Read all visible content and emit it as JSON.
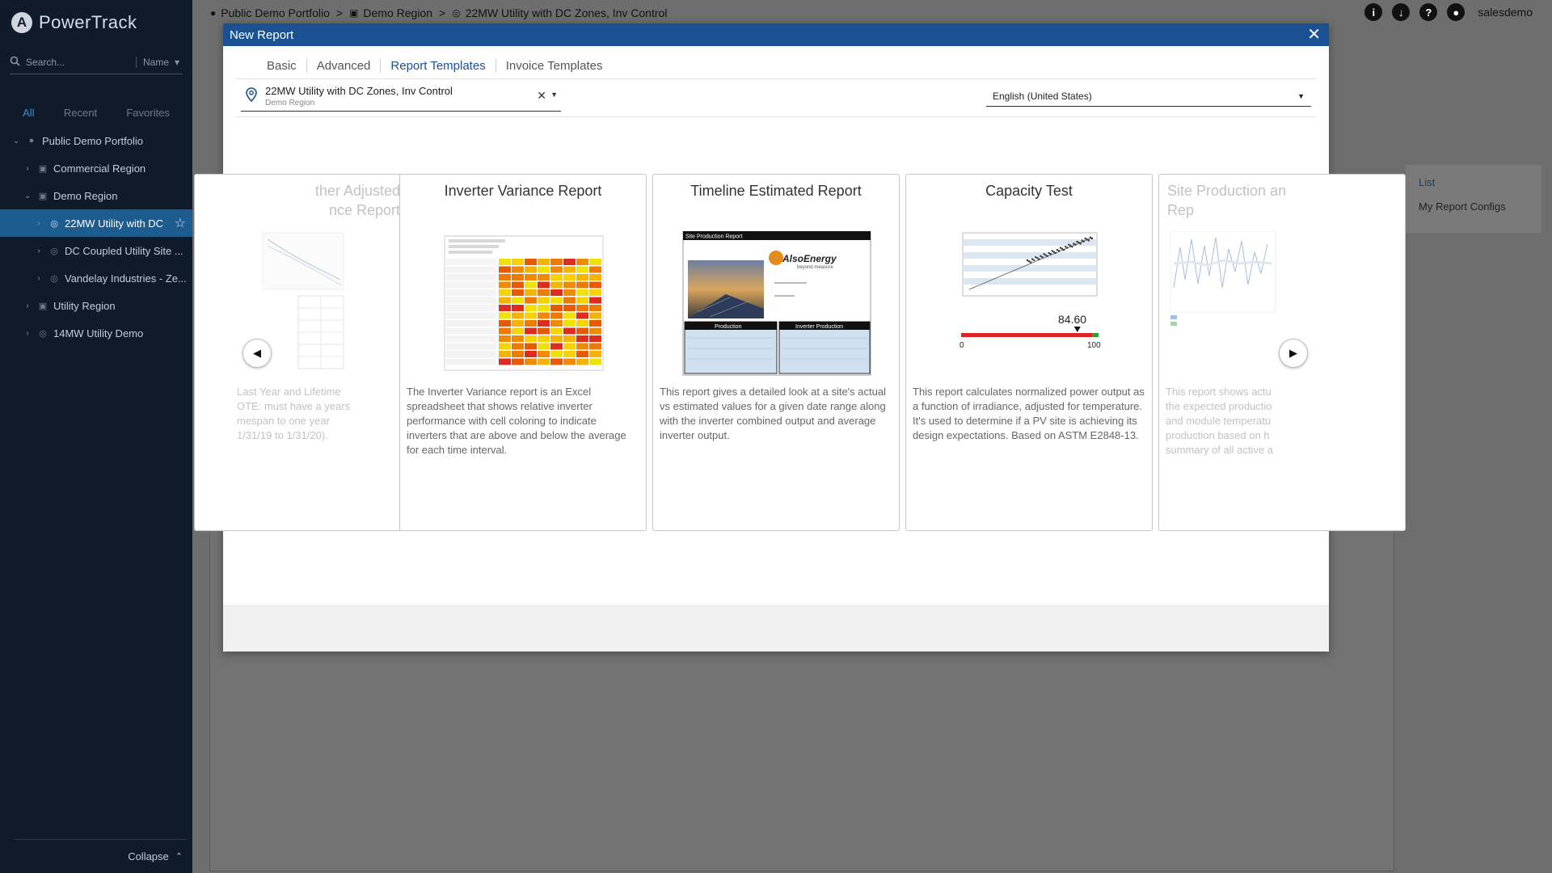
{
  "app": {
    "brand": "PowerTrack",
    "brand_initial": "A"
  },
  "sidebar": {
    "search_placeholder": "Search...",
    "sort_label": "Name",
    "tabs": [
      {
        "label": "All",
        "active": true
      },
      {
        "label": "Recent"
      },
      {
        "label": "Favorites"
      }
    ],
    "tree": [
      {
        "label": "Public Demo Portfolio",
        "level": 0,
        "chev": "⌄",
        "icon": "globe-icon"
      },
      {
        "label": "Commercial Region",
        "level": 1,
        "chev": "›",
        "icon": "briefcase-icon"
      },
      {
        "label": "Demo Region",
        "level": 1,
        "chev": "⌄",
        "icon": "briefcase-icon"
      },
      {
        "label": "22MW Utility with DC",
        "level": 2,
        "chev": "›",
        "icon": "pin-icon",
        "selected": true
      },
      {
        "label": "DC Coupled Utility Site ...",
        "level": 2,
        "chev": "›",
        "icon": "pin-icon"
      },
      {
        "label": "Vandelay Industries - Ze...",
        "level": 2,
        "chev": "›",
        "icon": "pin-icon"
      },
      {
        "label": "Utility Region",
        "level": 1,
        "chev": "›",
        "icon": "briefcase-icon"
      },
      {
        "label": "14MW Utility Demo",
        "level": 1,
        "chev": "›",
        "icon": "pin-icon"
      }
    ],
    "collapse_label": "Collapse"
  },
  "topbar": {
    "breadcrumb": [
      "Public Demo Portfolio",
      "Demo Region",
      "22MW Utility with DC Zones, Inv Control"
    ],
    "separator": ">",
    "user": "salesdemo",
    "info_glyph": "i",
    "help_glyph": "?"
  },
  "background": {
    "right_panel": [
      "List",
      "My Report Configs"
    ]
  },
  "modal": {
    "title": "New Report",
    "tabs": [
      {
        "label": "Basic"
      },
      {
        "label": "Advanced"
      },
      {
        "label": "Report Templates",
        "active": true
      },
      {
        "label": "Invoice Templates"
      }
    ],
    "site": {
      "name": "22MW Utility with DC Zones, Inv Control",
      "region": "Demo Region"
    },
    "language": "English (United States)",
    "cards": [
      {
        "title": "ther Adjusted\nnce Report",
        "desc": "Last Year and Lifetime\nOTE: must have a years\nmespan to one year\n1/31/19 to 1/31/20).",
        "faded": true
      },
      {
        "title": "Inverter Variance Report",
        "desc": "The Inverter Variance report is an Excel spreadsheet that shows relative inverter performance with cell coloring to indicate inverters that are above and below the average for each time interval."
      },
      {
        "title": "Timeline Estimated Report",
        "desc": "This report gives a detailed look at a site's actual vs estimated values for a given date range along with the inverter combined output and average inverter output.",
        "thumb": {
          "header": "Site Production Report",
          "brand_line1": "AlsoEnergy",
          "brand_line2": "beyond measure",
          "box_left": "Production",
          "box_right": "Inverter Production"
        }
      },
      {
        "title": "Capacity Test",
        "desc": "This report calculates normalized power output as a function of irradiance, adjusted for temperature. It's used to determine if a PV site is achieving its design expectations. Based on ASTM E2848-13.",
        "gauge": {
          "value": 84.6,
          "value_label": "84.60",
          "min_label": "0",
          "max_label": "100"
        }
      },
      {
        "title": "Site Production an\nRep",
        "desc": "This report shows actu\nthe expected productio\nand module temperatu\nproduction based on h\nsummary of all active a",
        "faded": true
      }
    ]
  },
  "colors": {
    "accent": "#1a5193",
    "sidebar_bg": "#0f1a2b",
    "selected": "#1d5c8f"
  }
}
